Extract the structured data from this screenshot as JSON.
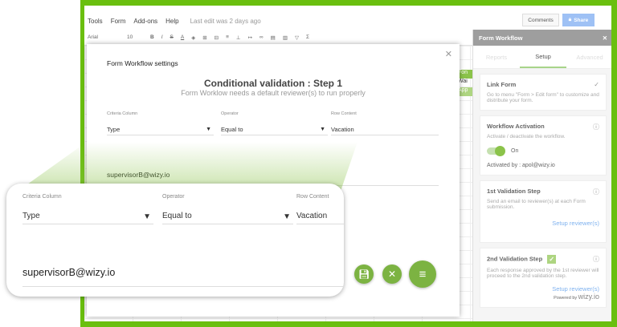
{
  "menubar": {
    "items": [
      "Tools",
      "Form",
      "Add-ons",
      "Help"
    ],
    "last_edit": "Last edit was 2 days ago",
    "comments": "Comments",
    "share": "Share"
  },
  "toolbar": {
    "font": "Arial",
    "size": "10",
    "bold": "B",
    "italic": "I",
    "strike": "S",
    "text_color": "A",
    "sigma": "Σ"
  },
  "cells": [
    "Fon",
    "Wai",
    "App"
  ],
  "sidebar": {
    "title": "Form Workflow",
    "tabs": [
      "Reports",
      "Setup",
      "Advanced"
    ],
    "link_form": {
      "title": "Link Form",
      "desc": "Go to menu \"Form > Edit form\" to customize and distribute your form."
    },
    "activation": {
      "title": "Workflow Activation",
      "desc": "Activate / deactivate the workflow.",
      "state": "On",
      "activated_by": "Activated by : apol@wizy.io"
    },
    "step1": {
      "title": "1st Validation Step",
      "desc": "Send an email to reviewer(s) at each Form submission.",
      "link": "Setup reviewer(s)"
    },
    "step2": {
      "title": "2nd Validation Step",
      "desc": "Each response approved by the 1st reviewer will proceed to the 2nd validation step.",
      "link": "Setup reviewer(s)"
    },
    "powered": "Powered by",
    "brand": "wizy.io"
  },
  "dialog": {
    "title": "Form Workflow settings",
    "heading": "Conditional validation : Step 1",
    "subheading": "Form Worklow needs a default reviewer(s) to run properly",
    "criteria_label": "Criteria Column",
    "criteria_value": "Type",
    "operator_label": "Operator",
    "operator_value": "Equal to",
    "row_label": "Row Content",
    "row_value": "Vacation",
    "email": "supervisorB@wizy.io"
  }
}
